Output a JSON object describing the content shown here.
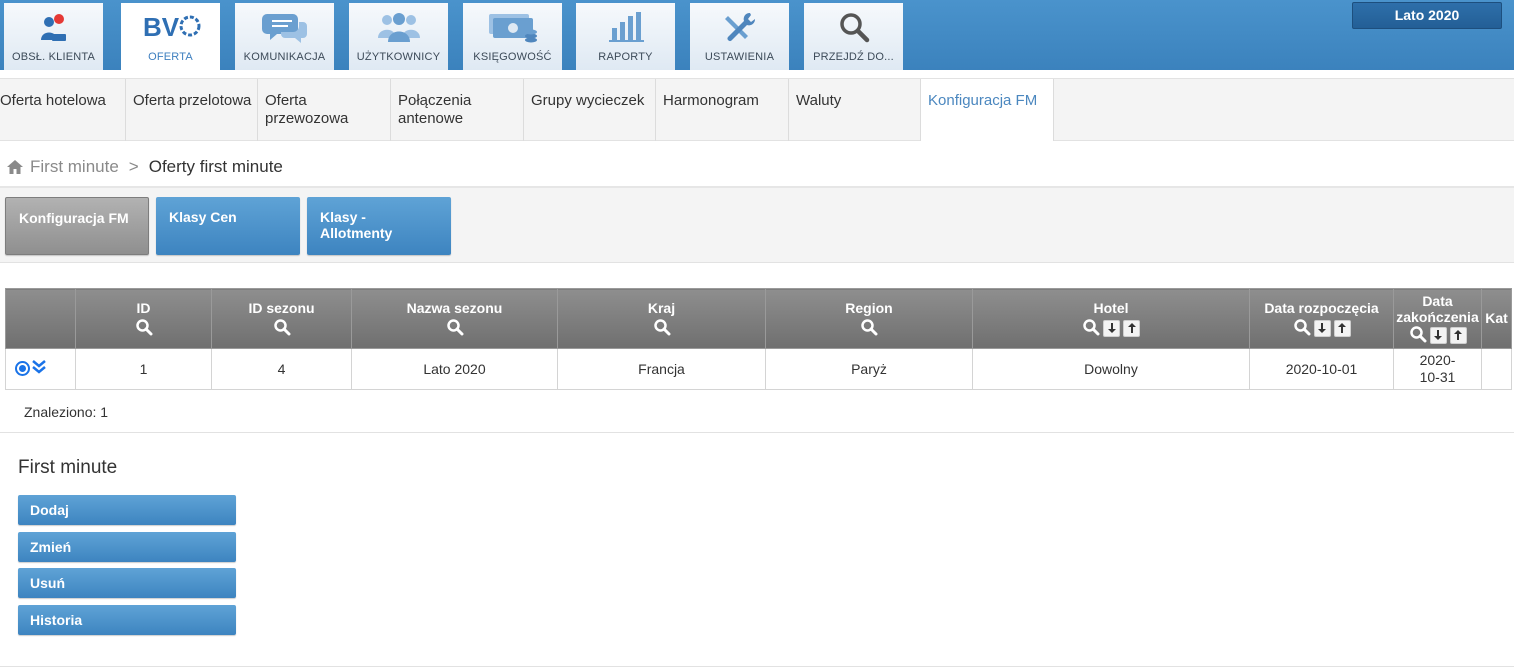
{
  "main_tabs": [
    {
      "label": "OBSŁ. KLIENTA",
      "icon": "customer-service-icon"
    },
    {
      "label": "OFERTA",
      "icon": "bv-logo-icon",
      "logo_text": "BV"
    },
    {
      "label": "KOMUNIKACJA",
      "icon": "chat-icon"
    },
    {
      "label": "UŻYTKOWNICY",
      "icon": "users-icon"
    },
    {
      "label": "KSIĘGOWOŚĆ",
      "icon": "money-icon"
    },
    {
      "label": "RAPORTY",
      "icon": "bar-chart-icon"
    },
    {
      "label": "USTAWIENIA",
      "icon": "tools-icon"
    },
    {
      "label": "PRZEJDŹ DO...",
      "icon": "search-icon"
    }
  ],
  "season_selector": "Lato 2020",
  "sub_tabs": [
    {
      "label": "Oferta hotelowa"
    },
    {
      "label": "Oferta przelotowa"
    },
    {
      "label": "Oferta przewozowa"
    },
    {
      "label": "Połączenia antenowe"
    },
    {
      "label": "Grupy wycieczek"
    },
    {
      "label": "Harmonogram"
    },
    {
      "label": "Waluty"
    },
    {
      "label": "Konfiguracja FM"
    }
  ],
  "breadcrumb": {
    "parent": "First minute",
    "separator": ">",
    "current": "Oferty first minute"
  },
  "section_buttons": [
    "Konfiguracja FM",
    "Klasy Cen",
    "Klasy - Allotmenty"
  ],
  "table": {
    "columns": [
      "ID",
      "ID sezonu",
      "Nazwa sezonu",
      "Kraj",
      "Region",
      "Hotel",
      "Data rozpoczęcia",
      "Data zakończenia",
      "Kat"
    ],
    "rows": [
      [
        "1",
        "4",
        "Lato 2020",
        "Francja",
        "Paryż",
        "Dowolny",
        "2020-10-01",
        "2020-10-31",
        ""
      ]
    ]
  },
  "found_text": "Znaleziono: 1",
  "panel_title": "First minute",
  "actions": [
    "Dodaj",
    "Zmień",
    "Usuń",
    "Historia"
  ],
  "colors": {
    "accent": "#3d84c0",
    "header_bar": "#4a93cc",
    "table_header": "#7f7f7f",
    "radio": "#1a73e8"
  }
}
